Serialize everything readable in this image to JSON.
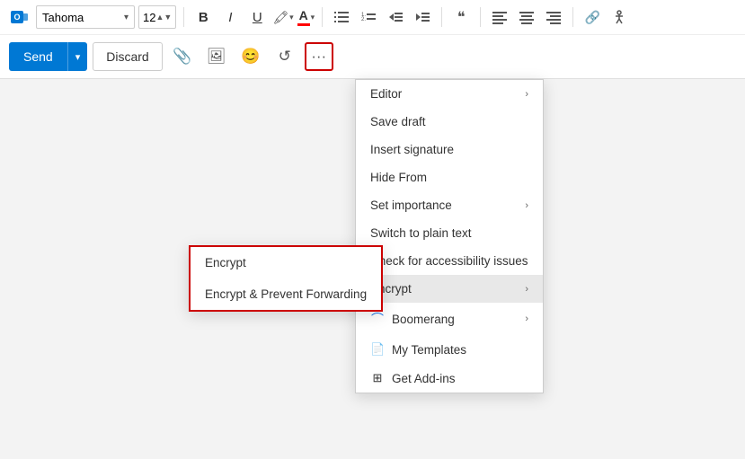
{
  "toolbar": {
    "font_name": "Tahoma",
    "font_size": "12",
    "bold_label": "B",
    "italic_label": "I",
    "underline_label": "U",
    "send_label": "Send",
    "discard_label": "Discard",
    "more_label": "···"
  },
  "menu": {
    "items": [
      {
        "id": "editor",
        "label": "Editor",
        "has_submenu": true,
        "icon": null
      },
      {
        "id": "save-draft",
        "label": "Save draft",
        "has_submenu": false,
        "icon": null
      },
      {
        "id": "insert-signature",
        "label": "Insert signature",
        "has_submenu": false,
        "icon": null
      },
      {
        "id": "hide-from",
        "label": "Hide From",
        "has_submenu": false,
        "icon": null
      },
      {
        "id": "set-importance",
        "label": "Set importance",
        "has_submenu": true,
        "icon": null
      },
      {
        "id": "switch-plain",
        "label": "Switch to plain text",
        "has_submenu": false,
        "icon": null
      },
      {
        "id": "accessibility",
        "label": "Check for accessibility issues",
        "has_submenu": false,
        "icon": null
      },
      {
        "id": "encrypt",
        "label": "Encrypt",
        "has_submenu": true,
        "icon": null,
        "active": true
      },
      {
        "id": "boomerang",
        "label": "Boomerang",
        "has_submenu": true,
        "icon": "boomerang"
      },
      {
        "id": "my-templates",
        "label": "My Templates",
        "has_submenu": false,
        "icon": "template"
      },
      {
        "id": "get-addins",
        "label": "Get Add-ins",
        "has_submenu": false,
        "icon": "addins"
      }
    ],
    "submenu": {
      "encrypt_items": [
        {
          "id": "encrypt-only",
          "label": "Encrypt"
        },
        {
          "id": "encrypt-prevent",
          "label": "Encrypt & Prevent Forwarding"
        }
      ]
    }
  },
  "colors": {
    "highlight_yellow": "#FFD700",
    "font_color_red": "#FF0000",
    "boomerang_blue": "#1a73e8",
    "send_blue": "#0078d4",
    "border_red": "#cc0000",
    "menu_active_bg": "#e8e8e8"
  }
}
